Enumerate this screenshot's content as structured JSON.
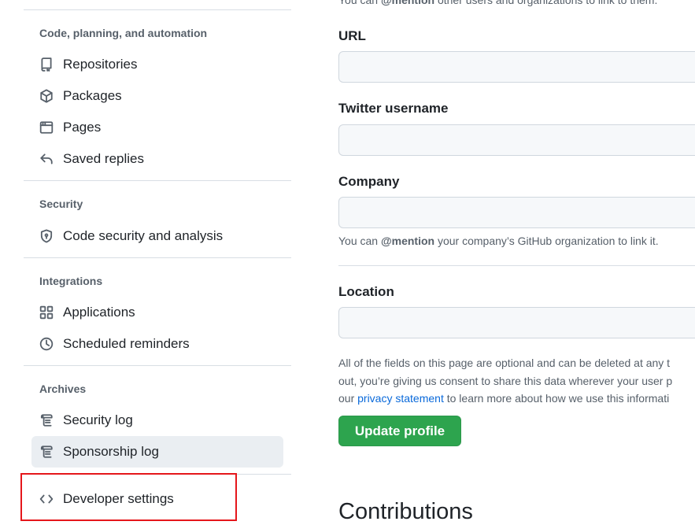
{
  "sidebar": {
    "groups": [
      {
        "title": "Code, planning, and automation",
        "items": [
          {
            "label": "Repositories",
            "icon": "repo-icon"
          },
          {
            "label": "Packages",
            "icon": "package-icon"
          },
          {
            "label": "Pages",
            "icon": "browser-icon"
          },
          {
            "label": "Saved replies",
            "icon": "reply-icon"
          }
        ]
      },
      {
        "title": "Security",
        "items": [
          {
            "label": "Code security and analysis",
            "icon": "shield-icon"
          }
        ]
      },
      {
        "title": "Integrations",
        "items": [
          {
            "label": "Applications",
            "icon": "apps-icon"
          },
          {
            "label": "Scheduled reminders",
            "icon": "clock-icon"
          }
        ]
      },
      {
        "title": "Archives",
        "items": [
          {
            "label": "Security log",
            "icon": "log-icon"
          },
          {
            "label": "Sponsorship log",
            "icon": "log-icon",
            "selected": true
          }
        ]
      }
    ],
    "developer_settings": {
      "label": "Developer settings",
      "icon": "code-icon"
    }
  },
  "main": {
    "top_note_prefix": "You can ",
    "top_note_mention": "@mention",
    "top_note_suffix": " other users and organizations to link to them.",
    "url": {
      "label": "URL",
      "value": ""
    },
    "twitter": {
      "label": "Twitter username",
      "value": ""
    },
    "company": {
      "label": "Company",
      "value": "",
      "note_prefix": "You can ",
      "note_mention": "@mention",
      "note_suffix": " your company’s GitHub organization to link it."
    },
    "location": {
      "label": "Location",
      "value": ""
    },
    "disclaimer": {
      "line1": "All of the fields on this page are optional and can be deleted at any t",
      "line2": "out, you’re giving us consent to share this data wherever your user p",
      "line3_prefix": "our ",
      "link": "privacy statement",
      "line3_suffix": " to learn more about how we use this informati"
    },
    "update_button": "Update profile",
    "contributions_heading": "Contributions"
  },
  "colors": {
    "primary_button": "#2da44e",
    "link": "#0969da",
    "highlight": "#e5161b"
  }
}
